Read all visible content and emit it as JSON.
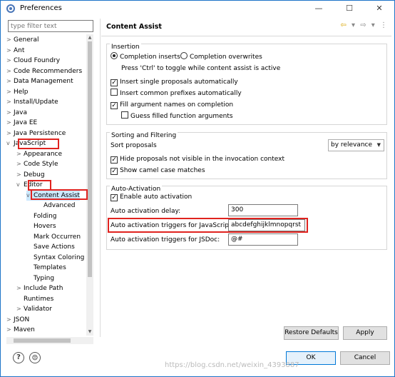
{
  "window": {
    "title": "Preferences",
    "minimize_glyph": "—",
    "maximize_glyph": "☐",
    "close_glyph": "✕"
  },
  "filter": {
    "placeholder": "type filter text"
  },
  "tree": {
    "items": [
      {
        "label": "General",
        "level": 0,
        "arrow": ">"
      },
      {
        "label": "Ant",
        "level": 0,
        "arrow": ">"
      },
      {
        "label": "Cloud Foundry",
        "level": 0,
        "arrow": ">"
      },
      {
        "label": "Code Recommenders",
        "level": 0,
        "arrow": ">"
      },
      {
        "label": "Data Management",
        "level": 0,
        "arrow": ">"
      },
      {
        "label": "Help",
        "level": 0,
        "arrow": ">"
      },
      {
        "label": "Install/Update",
        "level": 0,
        "arrow": ">"
      },
      {
        "label": "Java",
        "level": 0,
        "arrow": ">"
      },
      {
        "label": "Java EE",
        "level": 0,
        "arrow": ">"
      },
      {
        "label": "Java Persistence",
        "level": 0,
        "arrow": ">"
      },
      {
        "label": "JavaScript",
        "level": 0,
        "arrow": "v"
      },
      {
        "label": "Appearance",
        "level": 1,
        "arrow": ">"
      },
      {
        "label": "Code Style",
        "level": 1,
        "arrow": ">"
      },
      {
        "label": "Debug",
        "level": 1,
        "arrow": ">"
      },
      {
        "label": "Editor",
        "level": 1,
        "arrow": "v"
      },
      {
        "label": "Content Assist",
        "level": 2,
        "arrow": "v"
      },
      {
        "label": "Advanced",
        "level": 3,
        "arrow": ""
      },
      {
        "label": "Folding",
        "level": 2,
        "arrow": ""
      },
      {
        "label": "Hovers",
        "level": 2,
        "arrow": ""
      },
      {
        "label": "Mark Occurren",
        "level": 2,
        "arrow": ""
      },
      {
        "label": "Save Actions",
        "level": 2,
        "arrow": ""
      },
      {
        "label": "Syntax Coloring",
        "level": 2,
        "arrow": ""
      },
      {
        "label": "Templates",
        "level": 2,
        "arrow": ""
      },
      {
        "label": "Typing",
        "level": 2,
        "arrow": ""
      },
      {
        "label": "Include Path",
        "level": 1,
        "arrow": ">"
      },
      {
        "label": "Runtimes",
        "level": 1,
        "arrow": ""
      },
      {
        "label": "Validator",
        "level": 1,
        "arrow": ">"
      },
      {
        "label": "JSON",
        "level": 0,
        "arrow": ">"
      },
      {
        "label": "Maven",
        "level": 0,
        "arrow": ">"
      }
    ]
  },
  "page": {
    "title": "Content Assist",
    "nav_back": "⇦",
    "nav_dropdown": "▾",
    "nav_forward": "⇨",
    "nav_menu": "⋮",
    "insertion": {
      "label": "Insertion",
      "radio_inserts": "Completion inserts",
      "radio_overwrites": "Completion overwrites",
      "hint": "Press 'Ctrl' to toggle while content assist is active",
      "cb_single": "Insert single proposals automatically",
      "cb_prefixes": "Insert common prefixes automatically",
      "cb_fill": "Fill argument names on completion",
      "cb_guess": "Guess filled function arguments"
    },
    "sorting": {
      "label": "Sorting and Filtering",
      "sort_label": "Sort proposals",
      "sort_value": "by relevance",
      "cb_hide": "Hide proposals not visible in the invocation context",
      "cb_camel": "Show camel case matches"
    },
    "auto": {
      "label": "Auto-Activation",
      "cb_enable": "Enable auto activation",
      "delay_label": "Auto activation delay:",
      "delay_value": "300",
      "js_label": "Auto activation triggers for JavaScript:",
      "js_value": "abcdefghijklmnopqrst",
      "jsdoc_label": "Auto activation triggers for JSDoc:",
      "jsdoc_value": "@#"
    },
    "restore_button": "Restore Defaults",
    "apply_button": "Apply"
  },
  "footer": {
    "help_glyph": "?",
    "import_glyph": "⊜",
    "ok_button": "OK",
    "cancel_button": "Cancel",
    "watermark": "https://blog.csdn.net/weixin_4393887"
  },
  "colors": {
    "highlight": "#e0231f",
    "accent": "#0078d7"
  }
}
